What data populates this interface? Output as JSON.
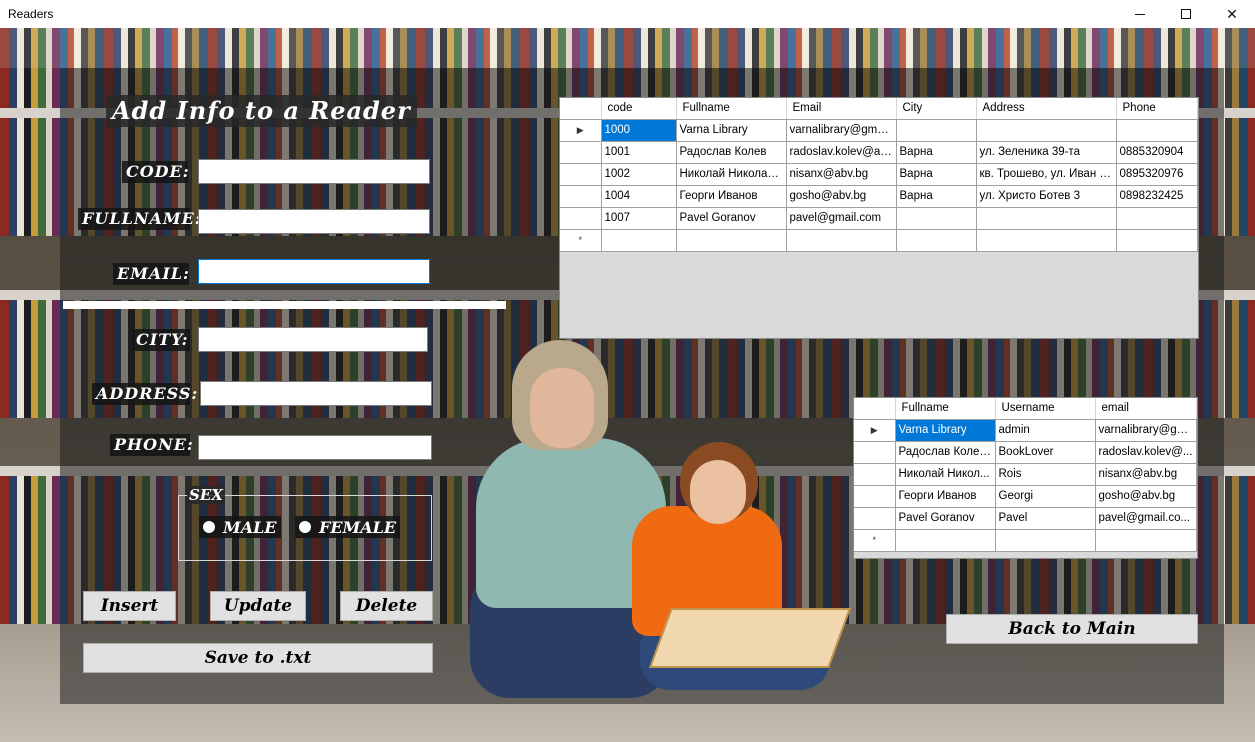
{
  "window": {
    "title": "Readers",
    "minimize_icon": "minimize-icon",
    "maximize_icon": "maximize-icon",
    "close_icon": "close-icon"
  },
  "form": {
    "heading": "Add Info to a Reader",
    "labels": {
      "code": "CODE:",
      "fullname": "FULLNAME:",
      "email": "EMAIL:",
      "city": "CITY:",
      "address": "ADDRESS:",
      "phone": "PHONE:"
    },
    "values": {
      "code": "",
      "fullname": "",
      "email": "",
      "city": "",
      "address": "",
      "phone": ""
    },
    "sex": {
      "legend": "SEX",
      "male": "MALE",
      "female": "FEMALE"
    },
    "buttons": {
      "insert": "Insert",
      "update": "Update",
      "delete": "Delete",
      "save_txt": "Save to .txt",
      "back_to_main": "Back to Main"
    }
  },
  "readers_grid": {
    "columns": [
      "code",
      "Fullname",
      "Email",
      "City",
      "Address",
      "Phone"
    ],
    "rows": [
      [
        "1000",
        "Varna Library",
        "varnalibrary@gmail....",
        "",
        "",
        ""
      ],
      [
        "1001",
        "Радослав Колев",
        "radoslav.kolev@ab...",
        "Варна",
        "ул. Зеленика 39-та",
        "0885320904"
      ],
      [
        "1002",
        "Николай Николае...",
        "nisanx@abv.bg",
        "Варна",
        "кв. Трошево, ул. Иван С...",
        "0895320976"
      ],
      [
        "1004",
        "Георги Иванов",
        "gosho@abv.bg",
        "Варна",
        "ул. Христо Ботев  3",
        "0898232425"
      ],
      [
        "1007",
        "Pavel Goranov",
        "pavel@gmail.com",
        "",
        "",
        ""
      ]
    ],
    "new_row_marker": "*",
    "current_row_marker": "▶"
  },
  "users_grid": {
    "columns": [
      "Fullname",
      "Username",
      "email"
    ],
    "rows": [
      [
        "Varna Library",
        "admin",
        "varnalibrary@gm..."
      ],
      [
        "Радослав Колев...",
        "BookLover",
        "radoslav.kolev@..."
      ],
      [
        "Николай Никол...",
        "Rois",
        "nisanx@abv.bg"
      ],
      [
        "Георги Иванов",
        "Georgi",
        "gosho@abv.bg"
      ],
      [
        "Pavel Goranov",
        "Pavel",
        "pavel@gmail.co..."
      ]
    ],
    "new_row_marker": "*",
    "current_row_marker": "▶"
  },
  "colors": {
    "selection": "#0078d7",
    "button_bg": "#e1e1e1",
    "overlay": "rgba(30,30,30,0.55)"
  }
}
